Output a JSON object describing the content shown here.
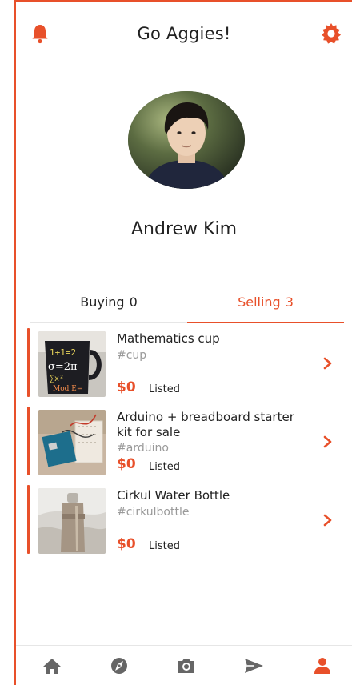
{
  "header": {
    "title": "Go Aggies!",
    "bell_icon": "bell-icon",
    "settings_icon": "gear-icon"
  },
  "profile": {
    "name": "Andrew Kim"
  },
  "tabs": [
    {
      "label": "Buying",
      "count": "0",
      "active": false
    },
    {
      "label": "Selling",
      "count": "3",
      "active": true
    }
  ],
  "listings": [
    {
      "name": "Mathematics cup",
      "tag": "#cup",
      "price": "$0",
      "status": "Listed"
    },
    {
      "name": "Arduino + breadboard starter kit for sale",
      "tag": "#arduino",
      "price": "$0",
      "status": "Listed"
    },
    {
      "name": "Cirkul Water Bottle",
      "tag": "#cirkulbottle",
      "price": "$0",
      "status": "Listed"
    }
  ],
  "bottom_nav": [
    {
      "icon": "home-icon",
      "active": false
    },
    {
      "icon": "compass-icon",
      "active": false
    },
    {
      "icon": "camera-icon",
      "active": false
    },
    {
      "icon": "send-icon",
      "active": false
    },
    {
      "icon": "person-icon",
      "active": true
    }
  ],
  "colors": {
    "accent": "#e8502a",
    "inactive_icon": "#666666",
    "text": "#222222",
    "muted": "#9a9a9a"
  }
}
